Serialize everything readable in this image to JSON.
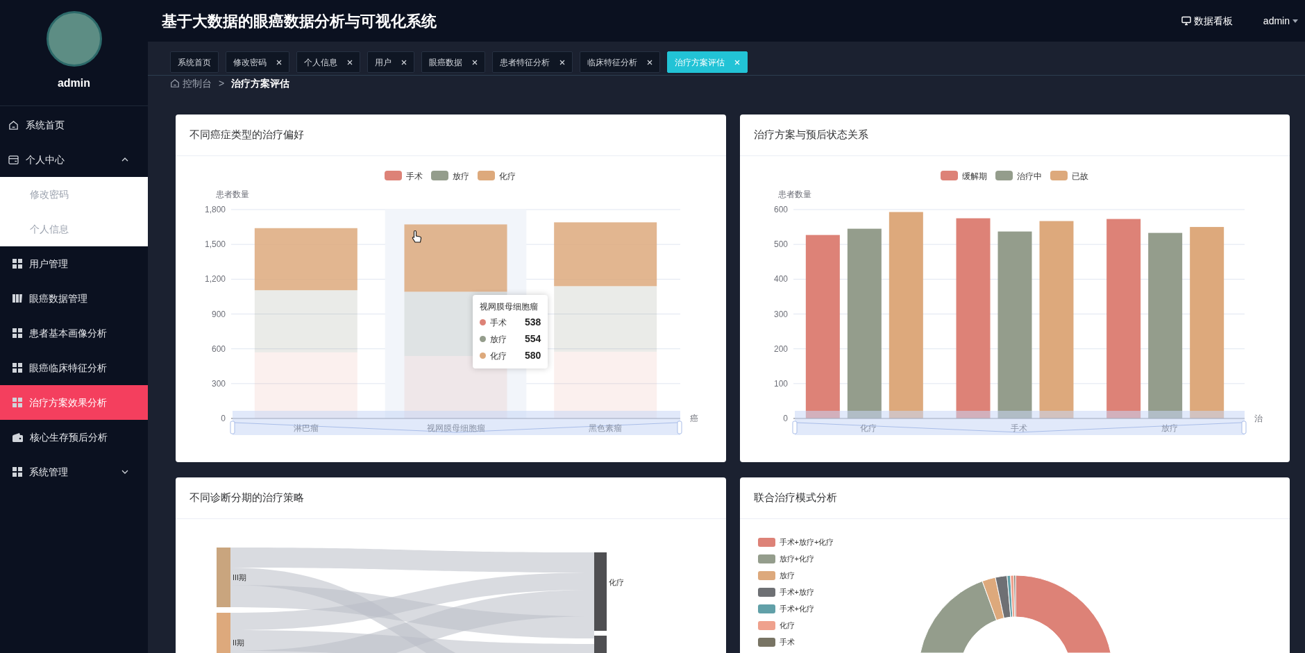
{
  "header": {
    "title": "基于大数据的眼癌数据分析与可视化系统",
    "dashboard_link": "数据看板",
    "user": "admin"
  },
  "sidebar": {
    "username": "admin",
    "menu": [
      {
        "label": "系统首页",
        "selected": false
      },
      {
        "label": "个人中心",
        "selected": false,
        "expanded": true,
        "children": [
          {
            "label": "修改密码",
            "selected": false
          },
          {
            "label": "个人信息",
            "selected": false
          }
        ]
      },
      {
        "label": "用户管理",
        "selected": false
      },
      {
        "label": "眼癌数据管理",
        "selected": false
      },
      {
        "label": "患者基本画像分析",
        "selected": false
      },
      {
        "label": "眼癌临床特征分析",
        "selected": false
      },
      {
        "label": "治疗方案效果分析",
        "selected": true
      },
      {
        "label": "核心生存预后分析",
        "selected": false
      },
      {
        "label": "系统管理",
        "selected": false,
        "expanded": false
      }
    ]
  },
  "tabs": [
    {
      "label": "系统首页",
      "closable": false,
      "selected": false
    },
    {
      "label": "修改密码",
      "closable": true,
      "selected": false
    },
    {
      "label": "个人信息",
      "closable": true,
      "selected": false
    },
    {
      "label": "用户",
      "closable": true,
      "selected": false
    },
    {
      "label": "眼癌数据",
      "closable": true,
      "selected": false
    },
    {
      "label": "患者特征分析",
      "closable": true,
      "selected": false
    },
    {
      "label": "临床特征分析",
      "closable": true,
      "selected": false
    },
    {
      "label": "治疗方案评估",
      "closable": true,
      "selected": true
    }
  ],
  "breadcrumb": {
    "items": [
      "控制台",
      "治疗方案评估"
    ],
    "separator": ">"
  },
  "cards": [
    {
      "title": "不同癌症类型的治疗偏好",
      "series_dimmed": [
        true,
        true,
        false
      ],
      "chart_data": {
        "type": "bar",
        "stacked": true,
        "grid": true,
        "legend": "top",
        "bands": [
          {
            "axis": "x",
            "from": "视网膜母细胞瘤",
            "to": "视网膜母细胞瘤"
          }
        ],
        "ylabel": "患者数量",
        "xlabel": "癌",
        "categories": [
          "淋巴瘤",
          "视网膜母细胞瘤",
          "黑色素瘤"
        ],
        "ylim": [
          0,
          1800
        ],
        "yticks": [
          0,
          {
            "value": 300,
            "label": "300"
          },
          {
            "value": 600,
            "label": "600"
          },
          {
            "value": 900,
            "label": "900"
          },
          {
            "value": 1200,
            "label": "1,200"
          },
          {
            "value": 1500,
            "label": "1,500"
          },
          {
            "value": 1800,
            "label": "1,800"
          }
        ],
        "series": [
          {
            "name": "手术",
            "color": "#dd8277",
            "values": [
              570,
              538,
              575
            ]
          },
          {
            "name": "放疗",
            "color": "#949d8c",
            "values": [
              535,
              554,
              565
            ]
          },
          {
            "name": "化疗",
            "color": "#dda97c",
            "values": [
              535,
              580,
              550
            ]
          }
        ]
      },
      "tooltip": {
        "title": "视网膜母细胞瘤",
        "rows": [
          {
            "label": "手术",
            "value": "538",
            "color": "#dd8277"
          },
          {
            "label": "放疗",
            "value": "554",
            "color": "#949d8c"
          },
          {
            "label": "化疗",
            "value": "580",
            "color": "#dda97c"
          }
        ]
      }
    },
    {
      "title": "治疗方案与预后状态关系",
      "chart_data": {
        "type": "bar",
        "stacked": false,
        "grid": true,
        "legend": "top",
        "ylabel": "患者数量",
        "xlabel": "治",
        "categories": [
          "化疗",
          "手术",
          "放疗"
        ],
        "ylim": [
          0,
          600
        ],
        "yticks": [
          0,
          100,
          200,
          300,
          400,
          500,
          600
        ],
        "series": [
          {
            "name": "缓解期",
            "color": "#dd8277",
            "values": [
              527,
              575,
              573
            ]
          },
          {
            "name": "治疗中",
            "color": "#949d8c",
            "values": [
              545,
              537,
              533
            ]
          },
          {
            "name": "已故",
            "color": "#dda97c",
            "values": [
              593,
              567,
              550
            ]
          }
        ]
      }
    },
    {
      "title": "不同诊断分期的治疗策略",
      "sankey_nodes": [
        {
          "label": "III期",
          "color": "#c9a57e"
        },
        {
          "label": "II期",
          "color": "#dda97c"
        },
        {
          "label": "化疗",
          "color": "#4f4f52"
        }
      ]
    },
    {
      "title": "联合治疗模式分析",
      "legend": [
        {
          "label": "手术+放疗+化疗",
          "color": "#dd8277"
        },
        {
          "label": "放疗+化疗",
          "color": "#949d8c"
        },
        {
          "label": "放疗",
          "color": "#dda97c"
        },
        {
          "label": "手术+放疗",
          "color": "#6e7074"
        },
        {
          "label": "手术+化疗",
          "color": "#61a0a8"
        },
        {
          "label": "化疗",
          "color": "#efa18d"
        },
        {
          "label": "手术",
          "color": "#787464"
        }
      ]
    }
  ]
}
